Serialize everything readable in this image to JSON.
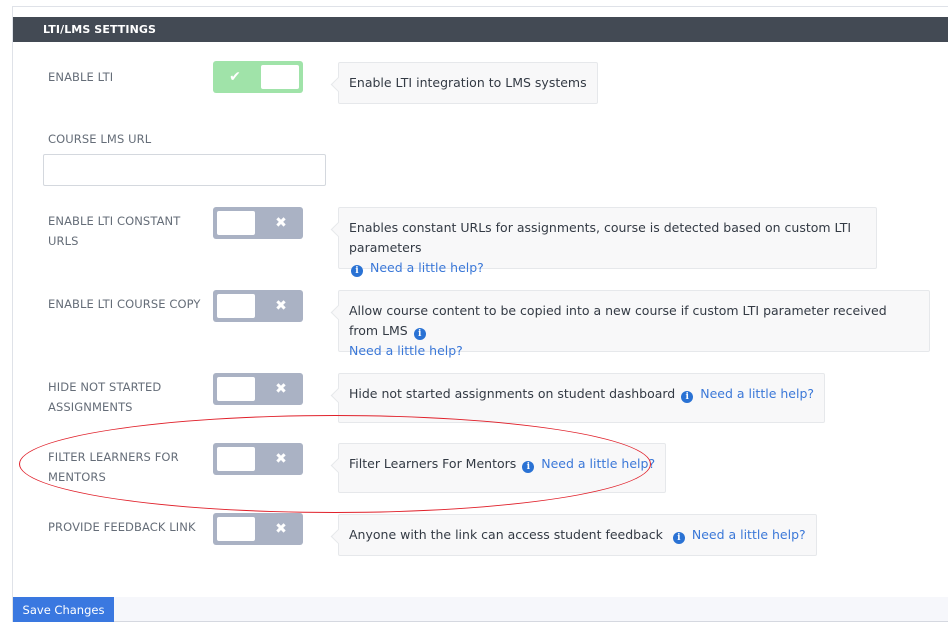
{
  "section": {
    "title": "LTI/LMS SETTINGS"
  },
  "settings": [
    {
      "label": "ENABLE LTI",
      "enabled": true,
      "description": "Enable LTI integration to LMS systems",
      "help_link": null
    },
    {
      "label": "ENABLE LTI CONSTANT URLS",
      "enabled": false,
      "description": "Enables constant URLs for assignments, course is detected based on custom LTI parameters",
      "help_link": "Need a little help?"
    },
    {
      "label": "ENABLE LTI COURSE COPY",
      "enabled": false,
      "description": "Allow course content to be copied into a new course if custom LTI parameter received from LMS",
      "help_link": "Need a little help?"
    },
    {
      "label": "HIDE NOT STARTED ASSIGNMENTS",
      "enabled": false,
      "description": "Hide not started assignments on student dashboard",
      "help_link": "Need a little help?"
    },
    {
      "label": "FILTER LEARNERS FOR MENTORS",
      "enabled": false,
      "description": "Filter Learners For Mentors",
      "help_link": "Need a little help?",
      "highlighted": true
    },
    {
      "label": "PROVIDE FEEDBACK LINK",
      "enabled": false,
      "description": "Anyone with the link can access student feedback",
      "help_link": "Need a little help?"
    }
  ],
  "course_lms_url": {
    "label": "COURSE LMS URL",
    "value": "",
    "placeholder": ""
  },
  "icons": {
    "check": "✔",
    "cross": "✖",
    "info": "i"
  },
  "footer": {
    "save_label": "Save Changes"
  },
  "colors": {
    "header_bg": "#434a54",
    "toggle_on": "#a0e3a9",
    "toggle_off": "#aab2c4",
    "link": "#3b78d8",
    "save_button": "#3a78e0",
    "annotation": "#e0202a"
  }
}
